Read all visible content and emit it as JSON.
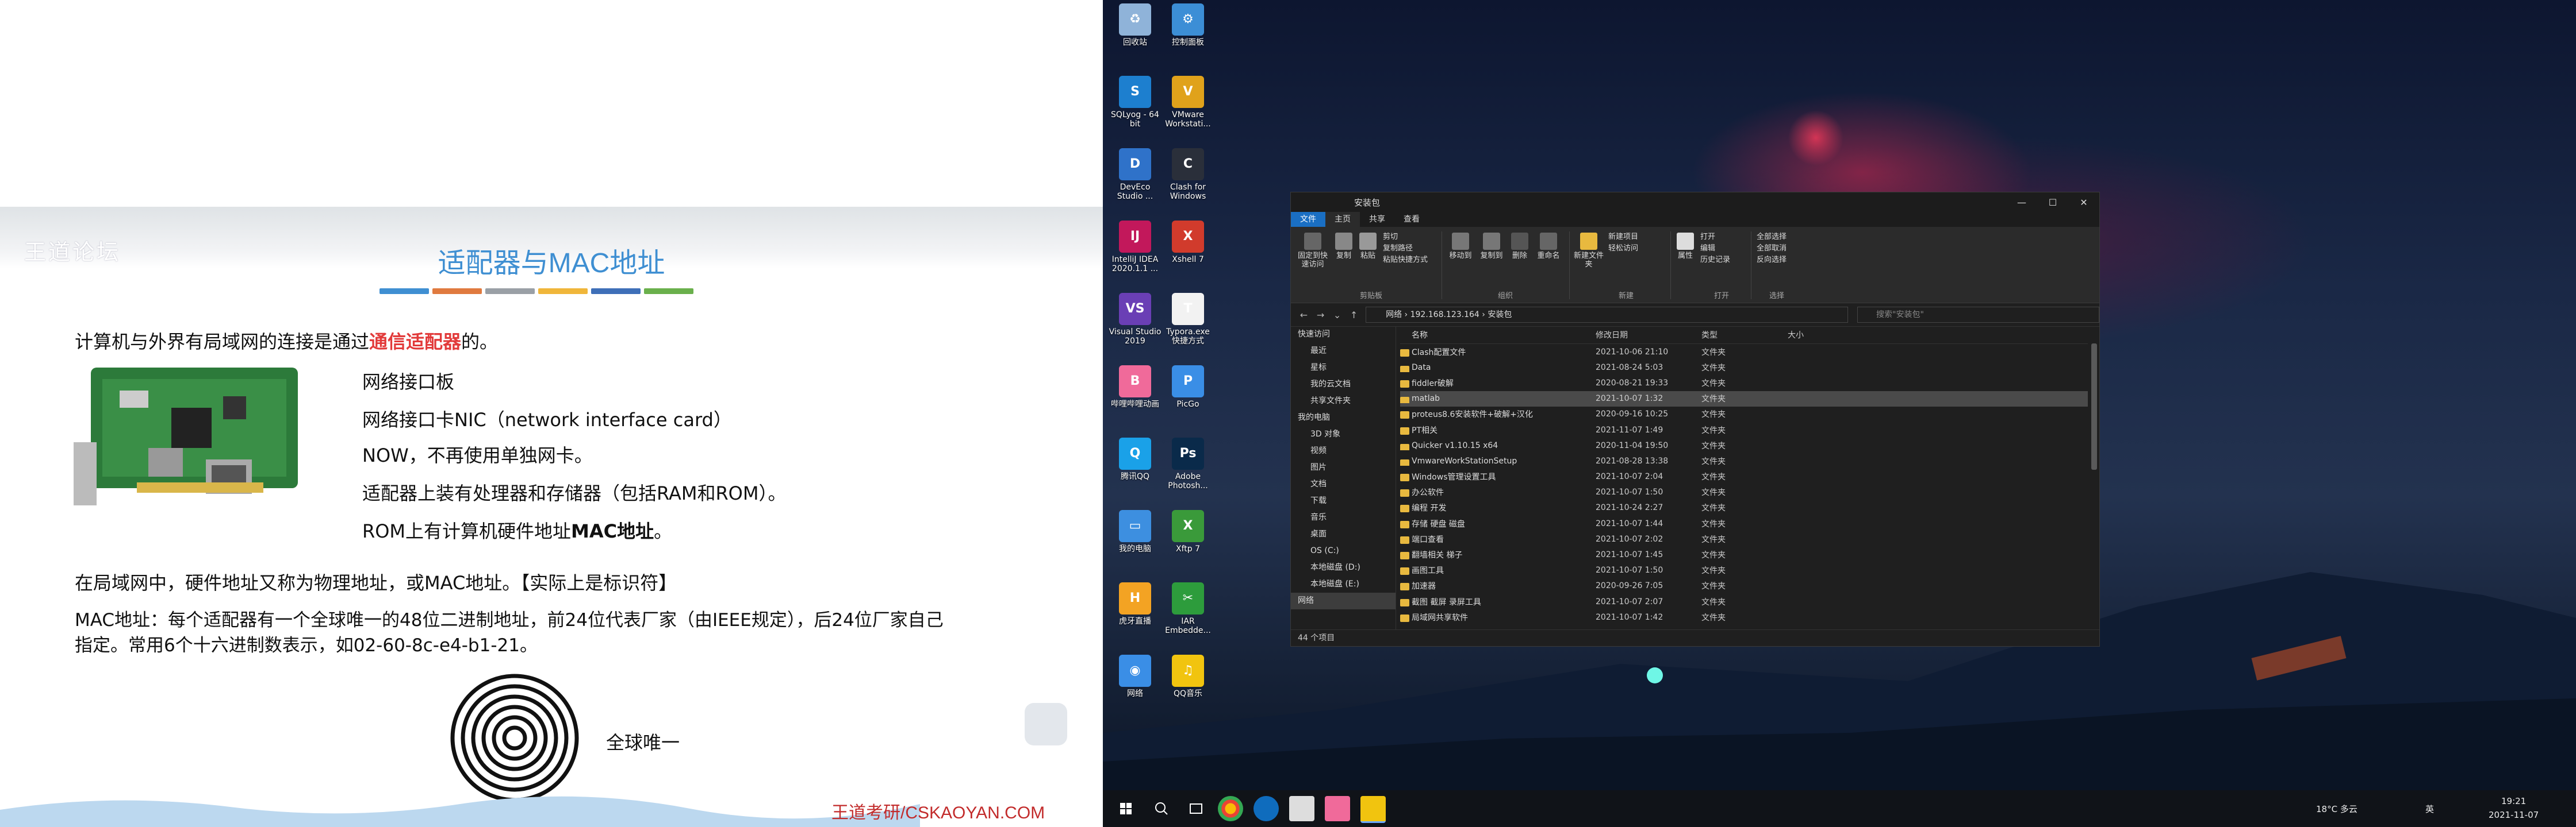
{
  "slide": {
    "logo": "王道论坛",
    "title": "适配器与MAC地址",
    "bar_colors": [
      "#3f8fd2",
      "#e07a3f",
      "#9aa0a6",
      "#f0b63a",
      "#3e6fb8",
      "#6ab04c"
    ],
    "intro_pre": "计算机与外界有局域网的连接是通过",
    "intro_red": "通信适配器",
    "intro_post": "的。",
    "nic_items": [
      "网络接口板",
      "网络接口卡NIC（network interface card）",
      "NOW，不再使用单独网卡。",
      "适配器上装有处理器和存储器（包括RAM和ROM）。"
    ],
    "rom_pre": "ROM上有计算机硬件地址",
    "rom_bold": "MAC地址",
    "rom_post": "。",
    "lan_line": "在局域网中，硬件地址又称为物理地址，或MAC地址。【实际上是标识符】",
    "mac_line1": "MAC地址：每个适配器有一个全球唯一的48位二进制地址，前24位代表厂家（由IEEE规定），后24位厂家自己",
    "mac_line2": "指定。常用6个十六进制数表示，如02-60-8c-e4-b1-21。",
    "unique": "全球唯一",
    "footer": "王道考研/CSKAOYAN.COM"
  },
  "desktop_icons": [
    {
      "label": "回收站",
      "color": "#8fb3d9",
      "glyph": "♻"
    },
    {
      "label": "控制面板",
      "color": "#3c8ed6",
      "glyph": "⚙"
    },
    {
      "label": "SQLyog - 64 bit",
      "color": "#1d7fcf",
      "glyph": "S"
    },
    {
      "label": "VMware Workstati...",
      "color": "#e0a21b",
      "glyph": "V"
    },
    {
      "label": "DevEco Studio ...",
      "color": "#2f72c9",
      "glyph": "D"
    },
    {
      "label": "Clash for Windows",
      "color": "#2a2f3a",
      "glyph": "C"
    },
    {
      "label": "IntelliJ IDEA 2020.1.1 ...",
      "color": "#c2185b",
      "glyph": "IJ"
    },
    {
      "label": "Xshell 7",
      "color": "#d13b2c",
      "glyph": "X"
    },
    {
      "label": "Visual Studio 2019",
      "color": "#6a3fb5",
      "glyph": "VS"
    },
    {
      "label": "Typora.exe 快捷方式",
      "color": "#f2f2f2",
      "glyph": "T"
    },
    {
      "label": "哔哩哔哩动画",
      "color": "#f06a9a",
      "glyph": "B"
    },
    {
      "label": "PicGo",
      "color": "#3a8ee6",
      "glyph": "P"
    },
    {
      "label": "腾讯QQ",
      "color": "#1aa1e8",
      "glyph": "Q"
    },
    {
      "label": "Adobe Photosh...",
      "color": "#0a2a4a",
      "glyph": "Ps"
    },
    {
      "label": "我的电脑",
      "color": "#3d8fe0",
      "glyph": "▭"
    },
    {
      "label": "Xftp 7",
      "color": "#3a9a3a",
      "glyph": "X"
    },
    {
      "label": "虎牙直播",
      "color": "#f3a323",
      "glyph": "H"
    },
    {
      "label": "IAR Embedde...",
      "color": "#2d9c3c",
      "glyph": "✂"
    },
    {
      "label": "网络",
      "color": "#3a8ee6",
      "glyph": "◉"
    },
    {
      "label": "QQ音乐",
      "color": "#f1c40f",
      "glyph": "♫"
    }
  ],
  "explorer": {
    "title": "安装包",
    "tabs": [
      "文件",
      "主页",
      "共享",
      "查看"
    ],
    "window_controls": [
      "—",
      "☐",
      "✕"
    ],
    "ribbon": {
      "pin": "固定到快速访问",
      "copy": "复制",
      "paste": "粘贴",
      "cut": "剪切",
      "copy_path": "复制路径",
      "paste_shortcut": "粘贴快捷方式",
      "clipboard_group": "剪贴板",
      "move_to": "移动到",
      "copy_to": "复制到",
      "delete": "删除",
      "rename": "重命名",
      "organize_group": "组织",
      "new_folder": "新建文件夹",
      "new_item": "新建项目",
      "easy_access": "轻松访问",
      "new_group": "新建",
      "properties": "属性",
      "open": "打开",
      "edit": "编辑",
      "history": "历史记录",
      "open_group": "打开",
      "select_all": "全部选择",
      "select_none": "全部取消",
      "invert": "反向选择",
      "select_group": "选择"
    },
    "path": "网络  ›  192.168.123.164  ›  安装包",
    "search_placeholder": "搜索\"安装包\"",
    "tree": [
      "快速访问",
      "最近",
      "星标",
      "我的云文档",
      "共享文件夹",
      "我的电脑",
      "3D 对象",
      "视频",
      "图片",
      "文档",
      "下载",
      "音乐",
      "桌面",
      "OS (C:)",
      "本地磁盘 (D:)",
      "本地磁盘 (E:)",
      "网络"
    ],
    "columns": [
      "名称",
      "修改日期",
      "类型",
      "大小"
    ],
    "files": [
      [
        "Clash配置文件",
        "2021-10-06 21:10",
        "文件夹",
        ""
      ],
      [
        "Data",
        "2021-08-24 5:03",
        "文件夹",
        ""
      ],
      [
        "fiddler破解",
        "2020-08-21 19:33",
        "文件夹",
        ""
      ],
      [
        "matlab",
        "2021-10-07 1:32",
        "文件夹",
        ""
      ],
      [
        "proteus8.6安装软件+破解+汉化",
        "2020-09-16 10:25",
        "文件夹",
        ""
      ],
      [
        "PT相关",
        "2021-11-07 1:49",
        "文件夹",
        ""
      ],
      [
        "Quicker v1.10.15 x64",
        "2020-11-04 19:50",
        "文件夹",
        ""
      ],
      [
        "VmwareWorkStationSetup",
        "2021-08-28 13:38",
        "文件夹",
        ""
      ],
      [
        "Windows管理设置工具",
        "2021-10-07 2:04",
        "文件夹",
        ""
      ],
      [
        "办公软件",
        "2021-10-07 1:50",
        "文件夹",
        ""
      ],
      [
        "编程 开发",
        "2021-10-24 2:27",
        "文件夹",
        ""
      ],
      [
        "存储 硬盘 磁盘",
        "2021-10-07 1:44",
        "文件夹",
        ""
      ],
      [
        "端口查看",
        "2021-10-07 2:02",
        "文件夹",
        ""
      ],
      [
        "翻墙相关 梯子",
        "2021-10-07 1:45",
        "文件夹",
        ""
      ],
      [
        "画图工具",
        "2021-10-07 1:50",
        "文件夹",
        ""
      ],
      [
        "加速器",
        "2020-09-26 7:05",
        "文件夹",
        ""
      ],
      [
        "截图 截屏 录屏工具",
        "2021-10-07 2:07",
        "文件夹",
        ""
      ],
      [
        "局域网共享软件",
        "2021-10-07 1:42",
        "文件夹",
        ""
      ]
    ],
    "status": "44 个项目"
  },
  "taskbar": {
    "weather": "18°C 多云",
    "ime": "英",
    "time": "19:21",
    "date": "2021-11-07"
  }
}
